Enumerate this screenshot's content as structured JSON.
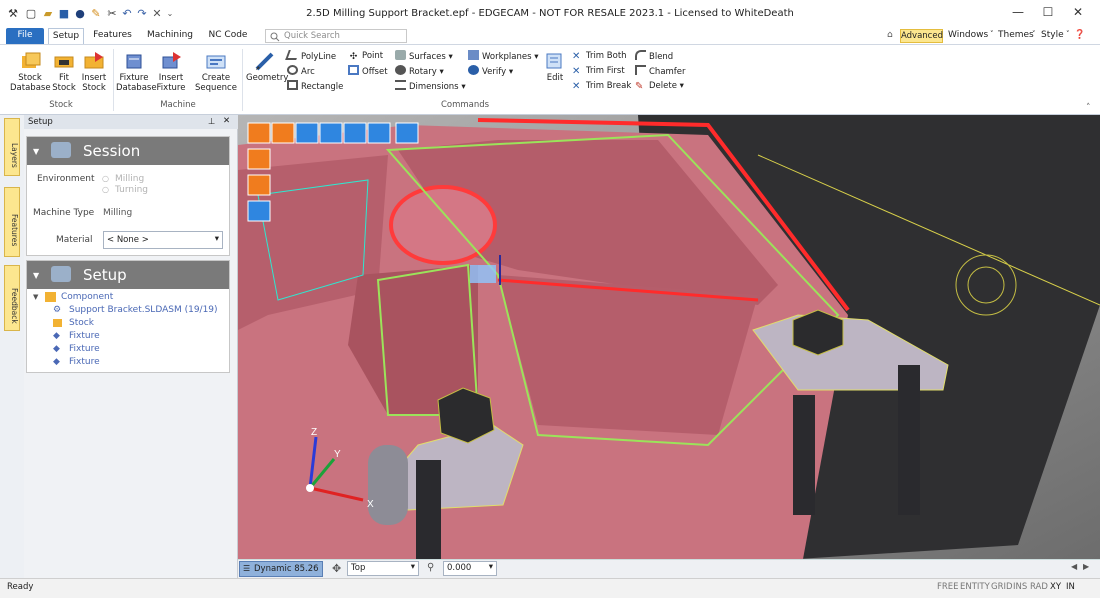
{
  "window": {
    "title": "2.5D Milling Support Bracket.epf - EDGECAM - NOT FOR RESALE 2023.1  - Licensed to WhiteDeath",
    "min": "—",
    "max": "☐",
    "close": "✕"
  },
  "quick_access": [
    "app",
    "new",
    "open",
    "save",
    "info",
    "clear",
    "cut",
    "undo",
    "redo",
    "close",
    "customize"
  ],
  "tabs": [
    "File",
    "Setup",
    "Features",
    "Machining",
    "NC Code"
  ],
  "active_tab": "Setup",
  "search": {
    "placeholder": "Quick Search"
  },
  "right_menu": {
    "advanced": "Advanced",
    "windows": "Windows",
    "themes": "Themes",
    "style": "Style"
  },
  "ribbon": {
    "stock": {
      "group": "Stock",
      "stock_database": "Stock\nDatabase",
      "fit_stock": "Fit\nStock",
      "insert_stock": "Insert\nStock"
    },
    "machine": {
      "group": "Machine",
      "fixture_database": "Fixture\nDatabase",
      "insert_fixture": "Insert\nFixture",
      "create_sequence": "Create\nSequence"
    },
    "commands": {
      "group": "Commands",
      "geometry": "Geometry",
      "polyline": "PolyLine",
      "arc": "Arc",
      "rectangle": "Rectangle",
      "point": "Point",
      "offset": "Offset",
      "surfaces": "Surfaces",
      "rotary": "Rotary",
      "dimensions": "Dimensions",
      "workplanes": "Workplanes",
      "verify": "Verify",
      "edit": "Edit",
      "trim_both": "Trim Both",
      "trim_first": "Trim First",
      "trim_break": "Trim Break",
      "blend": "Blend",
      "chamfer": "Chamfer",
      "delete": "Delete"
    }
  },
  "side_tabs": {
    "layers": "Layers",
    "features": "Features",
    "feedback": "Feedback"
  },
  "panel": {
    "title": "Setup",
    "session": {
      "heading": "Session",
      "environment_label": "Environment",
      "milling": "Milling",
      "turning": "Turning",
      "machine_type_label": "Machine Type",
      "machine_type_value": "Milling",
      "material_label": "Material",
      "material_value": "< None >"
    },
    "setup": {
      "heading": "Setup",
      "component": "Component",
      "items": [
        "Support Bracket.SLDASM (19/19)",
        "Stock",
        "Fixture",
        "Fixture",
        "Fixture"
      ]
    }
  },
  "viewport_bar": {
    "dynamic": "Dynamic 85.26",
    "view": "Top",
    "value": "0.000"
  },
  "axes": {
    "x": "X",
    "y": "Y",
    "z": "Z"
  },
  "status": {
    "left": "Ready",
    "flags": [
      "FREE",
      "ENTITY",
      "GRID",
      "INS",
      "RAD",
      "XY",
      "IN"
    ]
  },
  "colors": {
    "accent": "#2a6fc1",
    "part": "#c96a7a",
    "toolpath": "#9be35a",
    "highlight": "#fce68f"
  }
}
